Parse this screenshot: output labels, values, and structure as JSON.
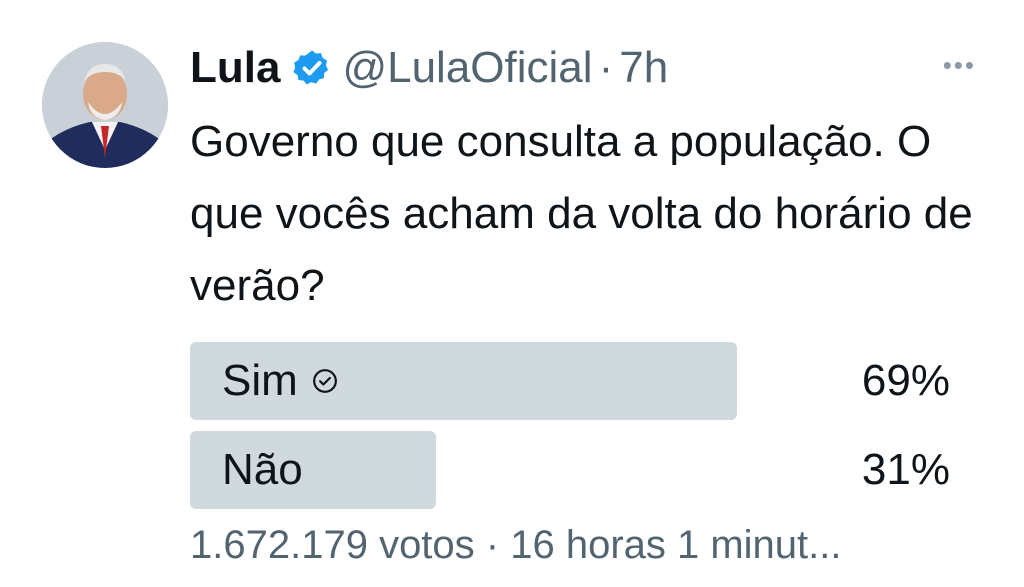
{
  "tweet": {
    "author_name": "Lula",
    "handle": "@LulaOficial",
    "separator": "·",
    "time": "7h",
    "text": "Governo que consulta a população. O que vocês acham da volta do horário de verão?",
    "more_label": "•••"
  },
  "poll": {
    "options": [
      {
        "label": "Sim",
        "percent_text": "69%",
        "percent": 69,
        "winner": true
      },
      {
        "label": "Não",
        "percent_text": "31%",
        "percent": 31,
        "winner": false
      }
    ],
    "footer": "1.672.179 votos · 16 horas 1 minut..."
  },
  "colors": {
    "verified_blue": "#1d9bf0",
    "bar": "#cfd9de",
    "secondary_text": "#536471"
  }
}
